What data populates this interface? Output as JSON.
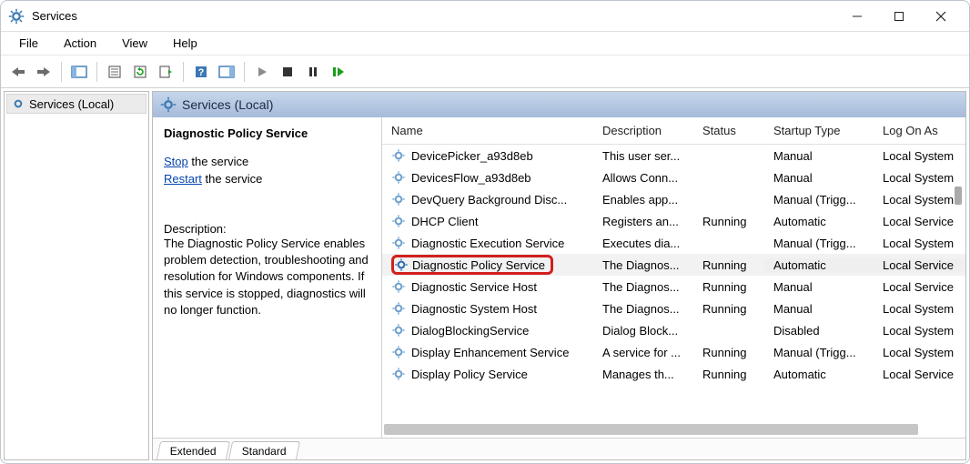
{
  "title": "Services",
  "menu": {
    "file": "File",
    "action": "Action",
    "view": "View",
    "help": "Help"
  },
  "tree": {
    "root": "Services (Local)"
  },
  "header": {
    "label": "Services (Local)"
  },
  "detail": {
    "selected_name": "Diagnostic Policy Service",
    "stop_label": "Stop",
    "stop_suffix": " the service",
    "restart_label": "Restart",
    "restart_suffix": " the service",
    "desc_label": "Description:",
    "desc_body": "The Diagnostic Policy Service enables problem detection, troubleshooting and resolution for Windows components.  If this service is stopped, diagnostics will no longer function."
  },
  "columns": {
    "name": "Name",
    "description": "Description",
    "status": "Status",
    "startup": "Startup Type",
    "logon": "Log On As"
  },
  "rows": [
    {
      "name": "DevicePicker_a93d8eb",
      "desc": "This user ser...",
      "status": "",
      "startup": "Manual",
      "logon": "Local System"
    },
    {
      "name": "DevicesFlow_a93d8eb",
      "desc": "Allows Conn...",
      "status": "",
      "startup": "Manual",
      "logon": "Local System"
    },
    {
      "name": "DevQuery Background Disc...",
      "desc": "Enables app...",
      "status": "",
      "startup": "Manual (Trigg...",
      "logon": "Local System"
    },
    {
      "name": "DHCP Client",
      "desc": "Registers an...",
      "status": "Running",
      "startup": "Automatic",
      "logon": "Local Service"
    },
    {
      "name": "Diagnostic Execution Service",
      "desc": "Executes dia...",
      "status": "",
      "startup": "Manual (Trigg...",
      "logon": "Local System"
    },
    {
      "name": "Diagnostic Policy Service",
      "desc": "The Diagnos...",
      "status": "Running",
      "startup": "Automatic",
      "logon": "Local Service",
      "selected": true,
      "highlight": true
    },
    {
      "name": "Diagnostic Service Host",
      "desc": "The Diagnos...",
      "status": "Running",
      "startup": "Manual",
      "logon": "Local Service"
    },
    {
      "name": "Diagnostic System Host",
      "desc": "The Diagnos...",
      "status": "Running",
      "startup": "Manual",
      "logon": "Local System"
    },
    {
      "name": "DialogBlockingService",
      "desc": "Dialog Block...",
      "status": "",
      "startup": "Disabled",
      "logon": "Local System"
    },
    {
      "name": "Display Enhancement Service",
      "desc": "A service for ...",
      "status": "Running",
      "startup": "Manual (Trigg...",
      "logon": "Local System"
    },
    {
      "name": "Display Policy Service",
      "desc": "Manages th...",
      "status": "Running",
      "startup": "Automatic",
      "logon": "Local Service"
    }
  ],
  "tabs": {
    "extended": "Extended",
    "standard": "Standard"
  }
}
